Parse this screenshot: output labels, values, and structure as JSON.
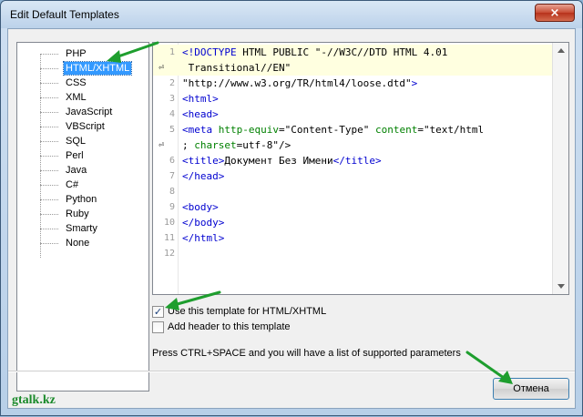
{
  "window": {
    "title": "Edit Default Templates",
    "close_label": "×"
  },
  "tree": {
    "items": [
      {
        "label": "PHP"
      },
      {
        "label": "HTML/XHTML",
        "selected": true
      },
      {
        "label": "CSS"
      },
      {
        "label": "XML"
      },
      {
        "label": "JavaScript"
      },
      {
        "label": "VBScript"
      },
      {
        "label": "SQL"
      },
      {
        "label": "Perl"
      },
      {
        "label": "Java"
      },
      {
        "label": "C#"
      },
      {
        "label": "Python"
      },
      {
        "label": "Ruby"
      },
      {
        "label": "Smarty"
      },
      {
        "label": "None"
      }
    ]
  },
  "editor": {
    "lines": [
      {
        "num": "1",
        "text": "<!DOCTYPE HTML PUBLIC \"-//W3C//DTD HTML 4.01"
      },
      {
        "num": "",
        "text": " Transitional//EN\"",
        "wrapped": true
      },
      {
        "num": "2",
        "text": "\"http://www.w3.org/TR/html4/loose.dtd\">"
      },
      {
        "num": "3",
        "text": "<html>"
      },
      {
        "num": "4",
        "text": "<head>"
      },
      {
        "num": "5",
        "text": "<meta http-equiv=\"Content-Type\" content=\"text/html"
      },
      {
        "num": "",
        "text": "; charset=utf-8\"/>",
        "wrapped": true
      },
      {
        "num": "6",
        "text": "<title>Документ Без Имени</title>"
      },
      {
        "num": "7",
        "text": "</head>"
      },
      {
        "num": "8",
        "text": ""
      },
      {
        "num": "9",
        "text": "<body>"
      },
      {
        "num": "10",
        "text": "</body>"
      },
      {
        "num": "11",
        "text": "</html>"
      },
      {
        "num": "12",
        "text": ""
      }
    ]
  },
  "options": {
    "use_template_label": "Use this template for HTML/XHTML",
    "use_template_checked": true,
    "add_header_label": "Add header to this template",
    "add_header_checked": false
  },
  "hint_text": "Press CTRL+SPACE and you will have a list of supported parameters",
  "buttons": {
    "cancel_label": "Отмена"
  },
  "watermark": "gtalk.kz",
  "colors": {
    "selection": "#3399ff",
    "tag": "#0000d0",
    "attribute": "#008000",
    "annotation_arrow": "#1e9e2e"
  }
}
